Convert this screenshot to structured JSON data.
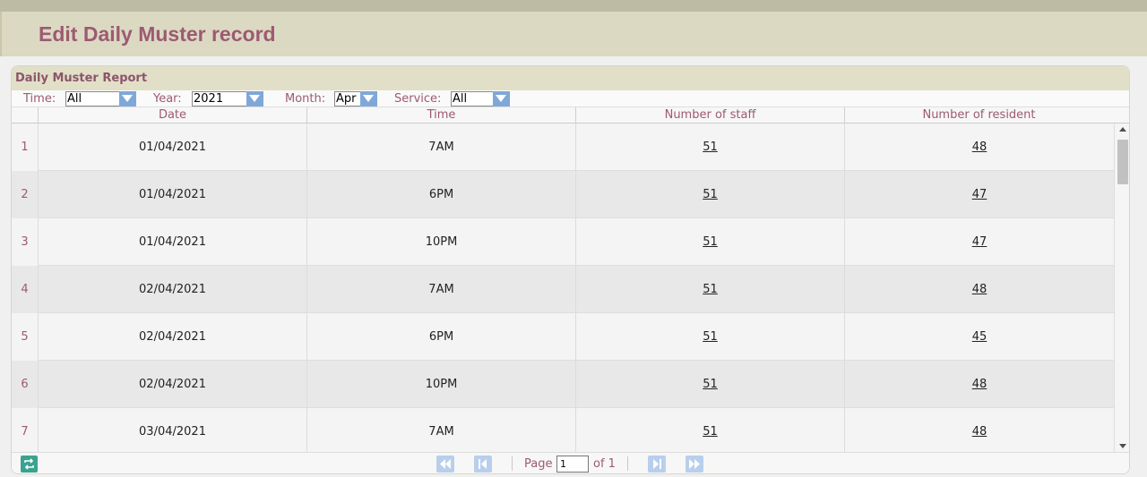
{
  "page": {
    "title": "Edit Daily Muster record"
  },
  "panel": {
    "title": "Daily Muster Report"
  },
  "filters": {
    "time": {
      "label": "Time:",
      "value": "All"
    },
    "year": {
      "label": "Year:",
      "value": "2021"
    },
    "month": {
      "label": "Month:",
      "value": "Apr"
    },
    "service": {
      "label": "Service:",
      "value": "All"
    }
  },
  "table": {
    "columns": [
      "Date",
      "Time",
      "Number of staff",
      "Number of resident"
    ],
    "rows": [
      {
        "idx": "1",
        "date": "01/04/2021",
        "time": "7AM",
        "staff": "51",
        "resident": "48"
      },
      {
        "idx": "2",
        "date": "01/04/2021",
        "time": "6PM",
        "staff": "51",
        "resident": "47"
      },
      {
        "idx": "3",
        "date": "01/04/2021",
        "time": "10PM",
        "staff": "51",
        "resident": "47"
      },
      {
        "idx": "4",
        "date": "02/04/2021",
        "time": "7AM",
        "staff": "51",
        "resident": "48"
      },
      {
        "idx": "5",
        "date": "02/04/2021",
        "time": "6PM",
        "staff": "51",
        "resident": "45"
      },
      {
        "idx": "6",
        "date": "02/04/2021",
        "time": "10PM",
        "staff": "51",
        "resident": "48"
      },
      {
        "idx": "7",
        "date": "03/04/2021",
        "time": "7AM",
        "staff": "51",
        "resident": "48"
      }
    ]
  },
  "pager": {
    "page_label": "Page",
    "page_value": "1",
    "of_label": "of 1"
  },
  "icons": {
    "refresh": "refresh-icon",
    "first": "first-page-icon",
    "prev": "prev-page-icon",
    "next": "next-page-icon",
    "last": "last-page-icon",
    "dropdown": "chevron-down-icon"
  },
  "colors": {
    "accent": "#9c5a72",
    "header_bg": "#dcd9c2",
    "select_button": "#7fa8d9"
  }
}
